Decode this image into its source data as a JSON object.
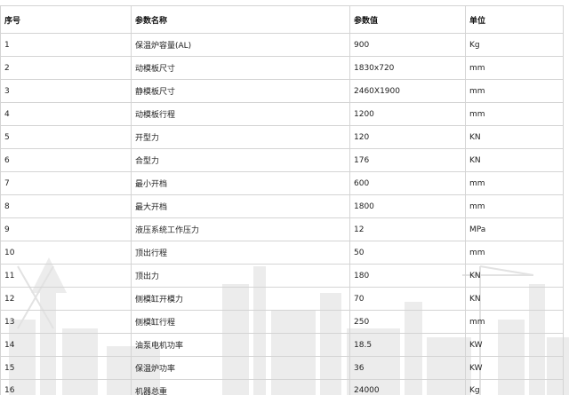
{
  "table": {
    "headers": [
      "序号",
      "参数名称",
      "参数值",
      "单位"
    ],
    "rows": [
      [
        "1",
        "保温炉容量(AL)",
        "900",
        "Kg"
      ],
      [
        "2",
        "动模板尺寸",
        "1830x720",
        "mm"
      ],
      [
        "3",
        "静模板尺寸",
        "2460X1900",
        "mm"
      ],
      [
        "4",
        "动模板行程",
        "1200",
        "mm"
      ],
      [
        "5",
        "开型力",
        "120",
        "KN"
      ],
      [
        "6",
        "合型力",
        "176",
        "KN"
      ],
      [
        "7",
        "最小开档",
        "600",
        "mm"
      ],
      [
        "8",
        "最大开档",
        "1800",
        "mm"
      ],
      [
        "9",
        "液压系统工作压力",
        "12",
        "MPa"
      ],
      [
        "10",
        "顶出行程",
        "50",
        "mm"
      ],
      [
        "11",
        "顶出力",
        "180",
        "KN"
      ],
      [
        "12",
        "侧模缸开模力",
        "70",
        "KN"
      ],
      [
        "13",
        "侧模缸行程",
        "250",
        "mm"
      ],
      [
        "14",
        "油泵电机功率",
        "18.5",
        "KW"
      ],
      [
        "15",
        "保温炉功率",
        "36",
        "KW"
      ],
      [
        "16",
        "机器总重",
        "24000",
        "Kg"
      ]
    ]
  }
}
